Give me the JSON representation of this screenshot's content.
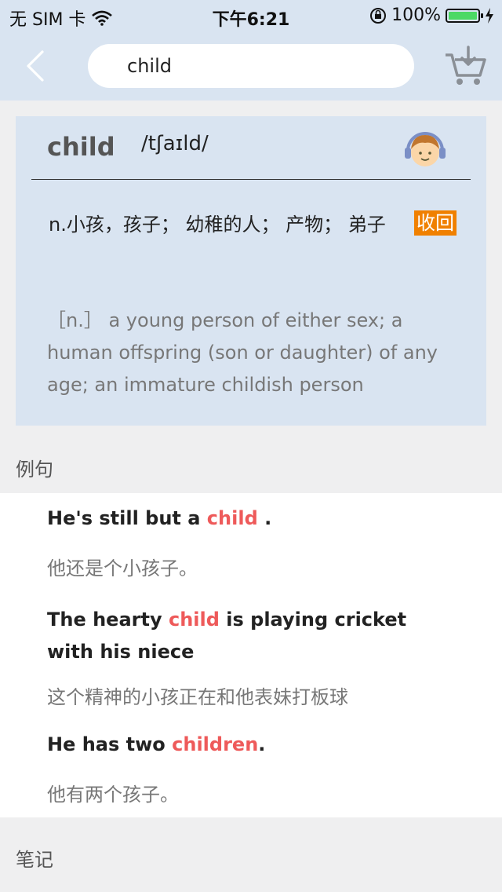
{
  "status": {
    "carrier": "无 SIM 卡",
    "time": "下午6:21",
    "battery": "100%",
    "battery_level": 1.0
  },
  "search": {
    "value": "child"
  },
  "entry": {
    "word": "child",
    "phonetic": "/tʃaɪld/",
    "cn_definition": "n.小孩，孩子； 幼稚的人； 产物； 弟子",
    "collapse_label": "收回",
    "en_definition": "［n.］ a young person of either sex; a human offspring (son or daughter) of any age; an immature childish person"
  },
  "sections": {
    "examples_title": "例句",
    "notes_title": "笔记"
  },
  "examples": [
    {
      "en_pre": "He's still but a ",
      "en_hl": "child",
      "en_post": " .",
      "cn": "他还是个小孩子。"
    },
    {
      "en_pre": "The hearty ",
      "en_hl": "child",
      "en_post": " is playing cricket with his niece",
      "cn": "这个精神的小孩正在和他表妹打板球"
    },
    {
      "en_pre": "He has two ",
      "en_hl": "children",
      "en_post": ".",
      "cn": "他有两个孩子。"
    }
  ],
  "colors": {
    "bar_bg": "#d9e4f1",
    "highlight": "#ee5a5a",
    "collapse_bg": "#f08000",
    "battery_fill": "#4cd964"
  },
  "icons": [
    "wifi-icon",
    "orientation-lock-icon",
    "battery-icon",
    "charging-icon",
    "back-chevron-icon",
    "cart-download-icon",
    "audio-avatar-icon"
  ]
}
